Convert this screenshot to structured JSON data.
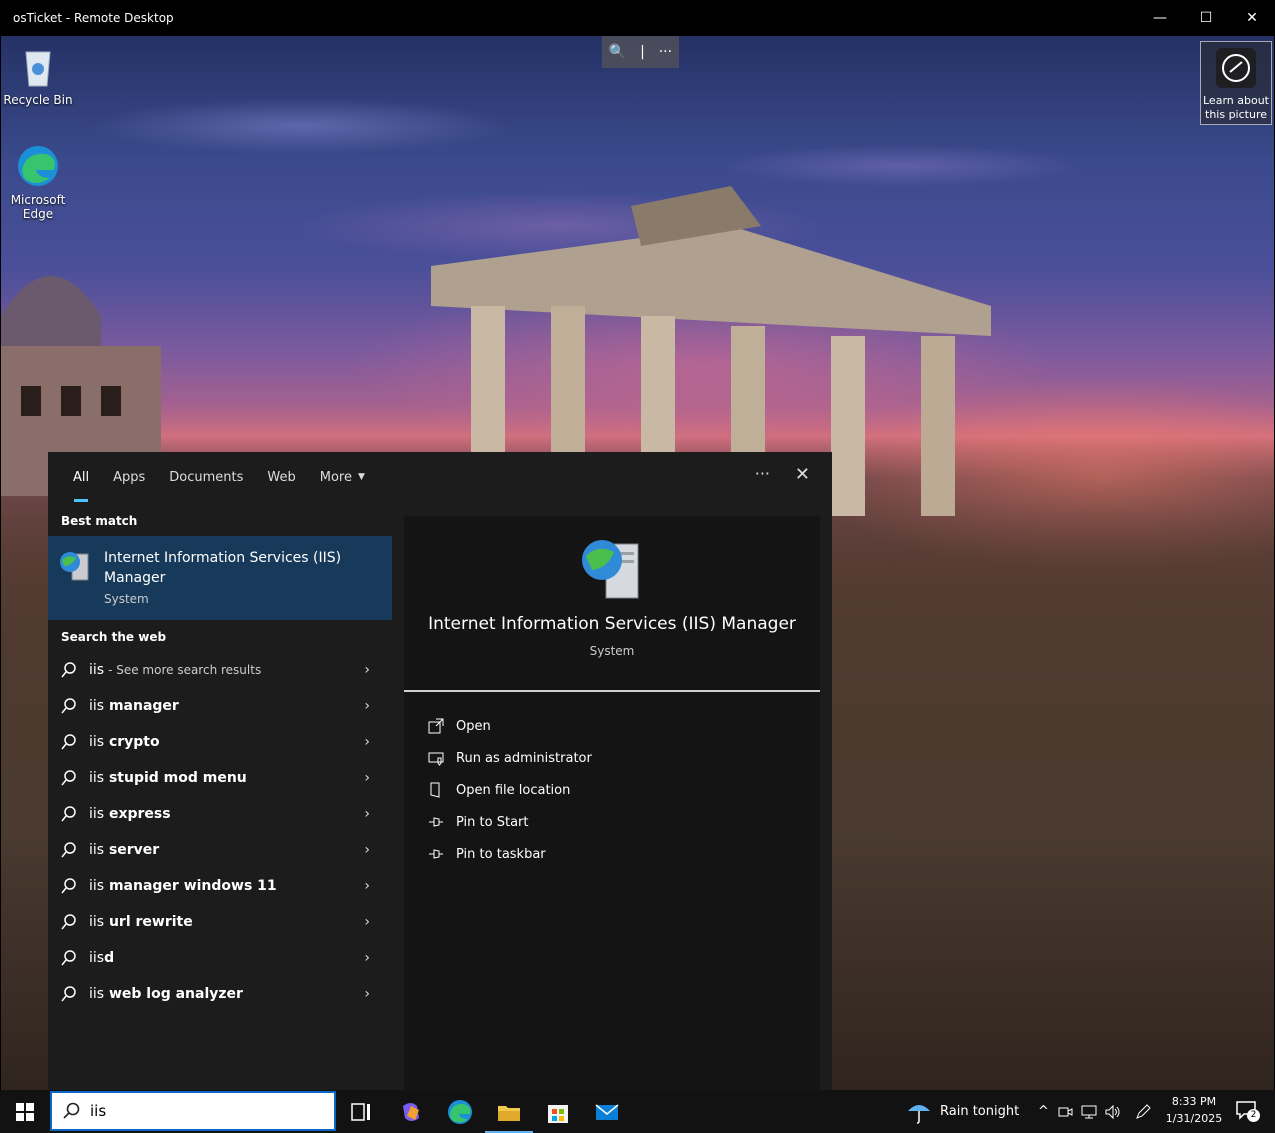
{
  "window": {
    "title": "osTicket - Remote Desktop",
    "minimize": "—",
    "maximize": "☐",
    "close": "✕"
  },
  "zoom_bar": {
    "zoom": "🔍",
    "sep": "|",
    "more": "···"
  },
  "desktop": {
    "icons": [
      {
        "label": "Recycle Bin"
      },
      {
        "label": "Microsoft Edge"
      }
    ],
    "learn": "Learn about this picture"
  },
  "search": {
    "tabs": [
      "All",
      "Apps",
      "Documents",
      "Web",
      "More"
    ],
    "more_caret": "▼",
    "dots": "···",
    "close": "✕",
    "best_match_label": "Best match",
    "best_match": {
      "title": "Internet Information Services (IIS) Manager",
      "sub": "System"
    },
    "web_label": "Search the web",
    "web_items": [
      {
        "query": "iis",
        "bold": "",
        "extra": "- See more search results"
      },
      {
        "query": "iis",
        "bold": " manager",
        "extra": ""
      },
      {
        "query": "iis",
        "bold": " crypto",
        "extra": ""
      },
      {
        "query": "iis",
        "bold": " stupid mod menu",
        "extra": ""
      },
      {
        "query": "iis",
        "bold": " express",
        "extra": ""
      },
      {
        "query": "iis",
        "bold": " server",
        "extra": ""
      },
      {
        "query": "iis",
        "bold": " manager windows 11",
        "extra": ""
      },
      {
        "query": "iis",
        "bold": " url rewrite",
        "extra": ""
      },
      {
        "query": "iis",
        "bold": "d",
        "extra": ""
      },
      {
        "query": "iis",
        "bold": " web log analyzer",
        "extra": ""
      }
    ],
    "chevron": "›",
    "preview": {
      "title": "Internet Information Services (IIS) Manager",
      "sub": "System"
    },
    "actions": [
      "Open",
      "Run as administrator",
      "Open file location",
      "Pin to Start",
      "Pin to taskbar"
    ]
  },
  "taskbar": {
    "search_value": "iis",
    "weather": "Rain tonight",
    "tray_caret": "^",
    "time": "8:33 PM",
    "date": "1/31/2025",
    "notif_count": "2"
  },
  "colors": {
    "accent": "#4cc2ff",
    "highlight": "#17395a",
    "panel": "#1c1c1c",
    "taskbar": "#121212"
  }
}
